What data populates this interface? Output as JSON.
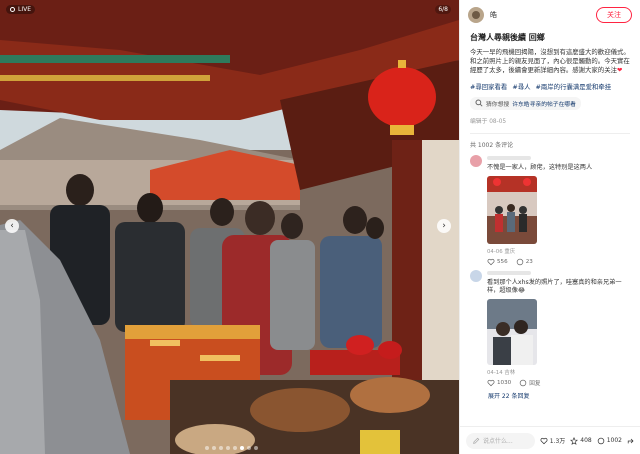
{
  "viewer": {
    "live_label": "LIVE",
    "counter": "6/8",
    "prev_icon": "‹",
    "next_icon": "›",
    "dot_count": 8,
    "active_dot": 5
  },
  "post": {
    "author_name": "皓",
    "follow_label": "关注",
    "title": "台灣人尋親後續 回鄉",
    "body": "今天一早的飛機回揭陽，沒想到有這麼盛大的歡迎儀式。和之前照片上的親友見面了，內心很是觸動的。今天實在經歷了太多，後續會更新詳細內容。感謝大家的关注",
    "heart": "❤",
    "tags": [
      "#尋回家看看",
      "#尋人",
      "#兩岸的行囊满是爱和牵挂"
    ],
    "search_prefix": "猜你想搜",
    "search_text": "许东皓寻亲的帖子在哪看",
    "date": "编辑于 08-05"
  },
  "comments_section": {
    "count_label": "共 1002 条评论",
    "comments": [
      {
        "text": "不愧是一家人，顾佬，这特别是这两人",
        "meta": "04-06 重庆",
        "likes": "556",
        "replies": "23"
      },
      {
        "text": "看到那个人xhs发的照片了，哇塞真的和亲兄弟一样，超级像😂",
        "meta": "04-14 吉林",
        "likes": "1030",
        "replies": "回复"
      }
    ],
    "expand_label": "展开 22 条回复"
  },
  "bottom": {
    "input_placeholder": "说点什么...",
    "likes": "1.3万",
    "collects": "408",
    "comments": "1002"
  },
  "colors": {
    "accent": "#ff2442",
    "link": "#13386c"
  }
}
